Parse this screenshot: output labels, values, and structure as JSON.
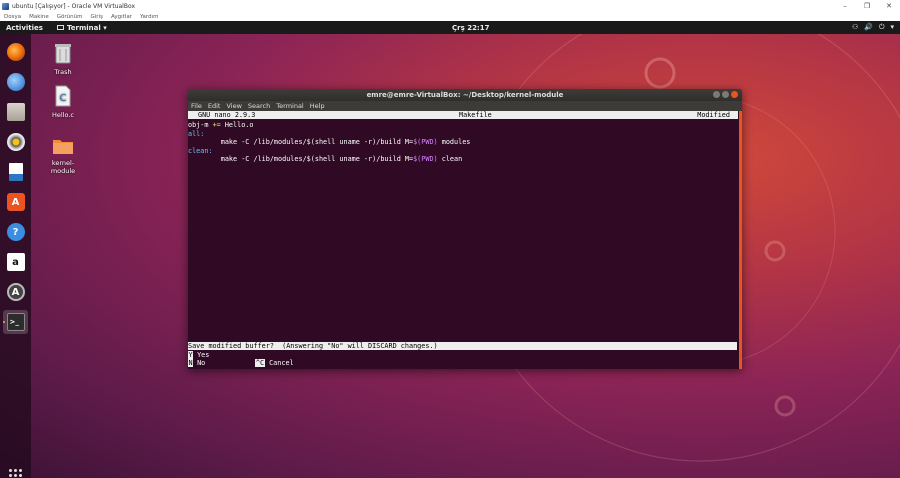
{
  "vbox": {
    "title": "ubuntu [Çalışıyor] - Oracle VM VirtualBox",
    "menu": [
      "Dosya",
      "Makine",
      "Görünüm",
      "Giriş",
      "Aygıtlar",
      "Yardım"
    ],
    "window_controls": [
      "–",
      "❐",
      "✕"
    ]
  },
  "topbar": {
    "activities": "Activities",
    "app": "Terminal ▾",
    "clock": "Çrş 22:17",
    "tray": [
      "⚇",
      "🔊",
      "⏻",
      "▾"
    ]
  },
  "dock": {
    "items": [
      "firefox-icon",
      "thunderbird-icon",
      "files-icon",
      "rhythmbox-icon",
      "writer-icon",
      "software-icon",
      "help-icon",
      "amazon-icon",
      "updater-icon",
      "terminal-icon"
    ]
  },
  "desktop": {
    "icons": [
      {
        "label": "Trash",
        "icon": "trash-icon"
      },
      {
        "label": "Hello.c",
        "icon": "c-file-icon"
      },
      {
        "label": "kernel-\nmodule",
        "icon": "folder-icon"
      }
    ]
  },
  "terminal": {
    "title": "emre@emre-VirtualBox: ~/Desktop/kernel-module",
    "menu": [
      "File",
      "Edit",
      "View",
      "Search",
      "Terminal",
      "Help"
    ],
    "nano": {
      "version": "GNU nano 2.9.3",
      "filename": "Makefile",
      "status": "Modified",
      "lines": {
        "l1a": "obj-m ",
        "l1b": "+=",
        "l1c": " Hello.o",
        "l2": "all:",
        "l3a": "        make -C /lib/modules/$(shell uname -r)/build M=",
        "l3b": "$(PWD)",
        "l3c": " modules",
        "l4": "clean:",
        "l5a": "        make -C /lib/modules/$(shell uname -r)/build M=",
        "l5b": "$(PWD)",
        "l5c": " clean"
      },
      "prompt": "Save modified buffer?  (Answering \"No\" will DISCARD changes.)",
      "options": [
        {
          "key": "Y",
          "label": "Yes"
        },
        {
          "key": "N",
          "label": "No"
        }
      ],
      "cancel_key": "^C",
      "cancel_label": "Cancel"
    }
  },
  "colors": {
    "accent": "#e95420",
    "terminal_bg": "#300a24",
    "topbar": "#1a1a1a"
  }
}
